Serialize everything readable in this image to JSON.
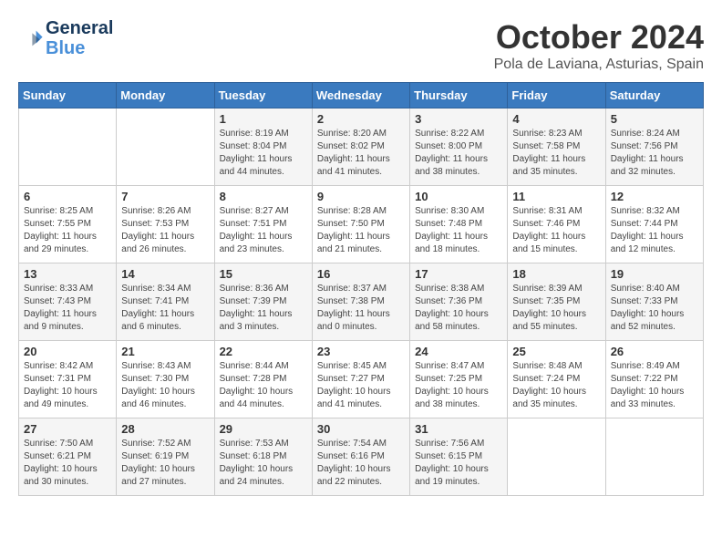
{
  "header": {
    "logo_line1": "General",
    "logo_line2": "Blue",
    "month": "October 2024",
    "location": "Pola de Laviana, Asturias, Spain"
  },
  "days_of_week": [
    "Sunday",
    "Monday",
    "Tuesday",
    "Wednesday",
    "Thursday",
    "Friday",
    "Saturday"
  ],
  "weeks": [
    [
      {
        "day": "",
        "detail": ""
      },
      {
        "day": "",
        "detail": ""
      },
      {
        "day": "1",
        "detail": "Sunrise: 8:19 AM\nSunset: 8:04 PM\nDaylight: 11 hours and 44 minutes."
      },
      {
        "day": "2",
        "detail": "Sunrise: 8:20 AM\nSunset: 8:02 PM\nDaylight: 11 hours and 41 minutes."
      },
      {
        "day": "3",
        "detail": "Sunrise: 8:22 AM\nSunset: 8:00 PM\nDaylight: 11 hours and 38 minutes."
      },
      {
        "day": "4",
        "detail": "Sunrise: 8:23 AM\nSunset: 7:58 PM\nDaylight: 11 hours and 35 minutes."
      },
      {
        "day": "5",
        "detail": "Sunrise: 8:24 AM\nSunset: 7:56 PM\nDaylight: 11 hours and 32 minutes."
      }
    ],
    [
      {
        "day": "6",
        "detail": "Sunrise: 8:25 AM\nSunset: 7:55 PM\nDaylight: 11 hours and 29 minutes."
      },
      {
        "day": "7",
        "detail": "Sunrise: 8:26 AM\nSunset: 7:53 PM\nDaylight: 11 hours and 26 minutes."
      },
      {
        "day": "8",
        "detail": "Sunrise: 8:27 AM\nSunset: 7:51 PM\nDaylight: 11 hours and 23 minutes."
      },
      {
        "day": "9",
        "detail": "Sunrise: 8:28 AM\nSunset: 7:50 PM\nDaylight: 11 hours and 21 minutes."
      },
      {
        "day": "10",
        "detail": "Sunrise: 8:30 AM\nSunset: 7:48 PM\nDaylight: 11 hours and 18 minutes."
      },
      {
        "day": "11",
        "detail": "Sunrise: 8:31 AM\nSunset: 7:46 PM\nDaylight: 11 hours and 15 minutes."
      },
      {
        "day": "12",
        "detail": "Sunrise: 8:32 AM\nSunset: 7:44 PM\nDaylight: 11 hours and 12 minutes."
      }
    ],
    [
      {
        "day": "13",
        "detail": "Sunrise: 8:33 AM\nSunset: 7:43 PM\nDaylight: 11 hours and 9 minutes."
      },
      {
        "day": "14",
        "detail": "Sunrise: 8:34 AM\nSunset: 7:41 PM\nDaylight: 11 hours and 6 minutes."
      },
      {
        "day": "15",
        "detail": "Sunrise: 8:36 AM\nSunset: 7:39 PM\nDaylight: 11 hours and 3 minutes."
      },
      {
        "day": "16",
        "detail": "Sunrise: 8:37 AM\nSunset: 7:38 PM\nDaylight: 11 hours and 0 minutes."
      },
      {
        "day": "17",
        "detail": "Sunrise: 8:38 AM\nSunset: 7:36 PM\nDaylight: 10 hours and 58 minutes."
      },
      {
        "day": "18",
        "detail": "Sunrise: 8:39 AM\nSunset: 7:35 PM\nDaylight: 10 hours and 55 minutes."
      },
      {
        "day": "19",
        "detail": "Sunrise: 8:40 AM\nSunset: 7:33 PM\nDaylight: 10 hours and 52 minutes."
      }
    ],
    [
      {
        "day": "20",
        "detail": "Sunrise: 8:42 AM\nSunset: 7:31 PM\nDaylight: 10 hours and 49 minutes."
      },
      {
        "day": "21",
        "detail": "Sunrise: 8:43 AM\nSunset: 7:30 PM\nDaylight: 10 hours and 46 minutes."
      },
      {
        "day": "22",
        "detail": "Sunrise: 8:44 AM\nSunset: 7:28 PM\nDaylight: 10 hours and 44 minutes."
      },
      {
        "day": "23",
        "detail": "Sunrise: 8:45 AM\nSunset: 7:27 PM\nDaylight: 10 hours and 41 minutes."
      },
      {
        "day": "24",
        "detail": "Sunrise: 8:47 AM\nSunset: 7:25 PM\nDaylight: 10 hours and 38 minutes."
      },
      {
        "day": "25",
        "detail": "Sunrise: 8:48 AM\nSunset: 7:24 PM\nDaylight: 10 hours and 35 minutes."
      },
      {
        "day": "26",
        "detail": "Sunrise: 8:49 AM\nSunset: 7:22 PM\nDaylight: 10 hours and 33 minutes."
      }
    ],
    [
      {
        "day": "27",
        "detail": "Sunrise: 7:50 AM\nSunset: 6:21 PM\nDaylight: 10 hours and 30 minutes."
      },
      {
        "day": "28",
        "detail": "Sunrise: 7:52 AM\nSunset: 6:19 PM\nDaylight: 10 hours and 27 minutes."
      },
      {
        "day": "29",
        "detail": "Sunrise: 7:53 AM\nSunset: 6:18 PM\nDaylight: 10 hours and 24 minutes."
      },
      {
        "day": "30",
        "detail": "Sunrise: 7:54 AM\nSunset: 6:16 PM\nDaylight: 10 hours and 22 minutes."
      },
      {
        "day": "31",
        "detail": "Sunrise: 7:56 AM\nSunset: 6:15 PM\nDaylight: 10 hours and 19 minutes."
      },
      {
        "day": "",
        "detail": ""
      },
      {
        "day": "",
        "detail": ""
      }
    ]
  ]
}
